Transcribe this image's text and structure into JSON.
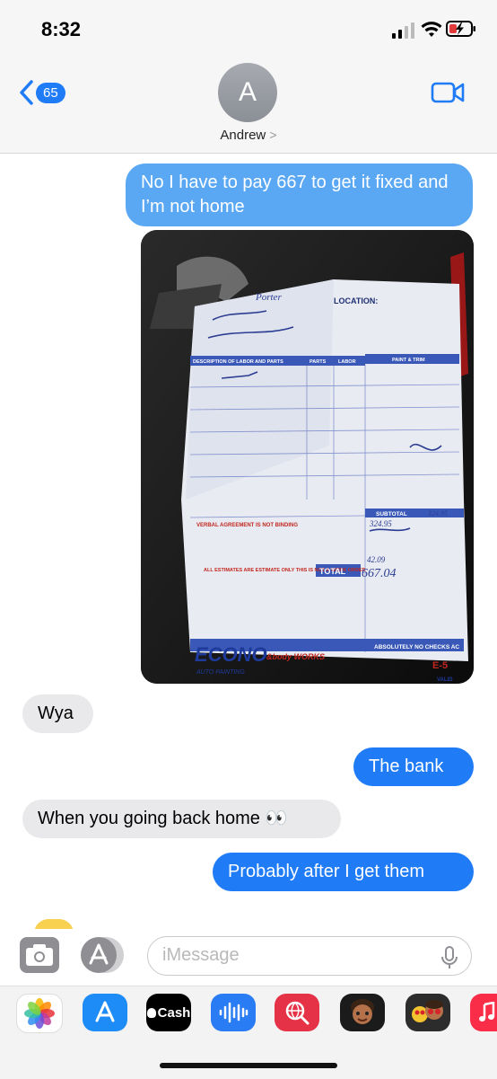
{
  "status_bar": {
    "time": "8:32"
  },
  "header": {
    "back_badge": "65",
    "avatar_initial": "A",
    "contact_name": "Andrew",
    "name_chevron": ">"
  },
  "messages": [
    {
      "type": "sent",
      "text": "No I have to pay 667 to get it fixed and I’m not home"
    },
    {
      "type": "sent-image",
      "text": ""
    },
    {
      "type": "received",
      "text": "Wya"
    },
    {
      "type": "sent",
      "text": "The bank"
    },
    {
      "type": "received",
      "text": "When you going back home 👀"
    },
    {
      "type": "sent",
      "text": "Probably after I get them"
    }
  ],
  "photo": {
    "location_label": "LOCATION:",
    "name_handwritten": "Porter",
    "description_header": "DESCRIPTION OF LABOR AND PARTS",
    "parts_header": "PARTS",
    "labor_header": "LABOR",
    "paint_header": "PAINT & TRIM",
    "verbal_agreement": "VERBAL AGREEMENT IS NOT BINDING",
    "estimates_note": "ALL ESTIMATES ARE ESTIMATE ONLY THIS IS NOT A WORK ORDER",
    "subtotal_label": "SUBTOTAL",
    "subtotal_value": "324.95",
    "total_label": "TOTAL",
    "total_value": "667.04",
    "paint_value": "324.95",
    "tax_value": "42.09",
    "brand": "ECONO",
    "brand_sub": "&body WORKS",
    "brand_tag": "AUTO PAINTING",
    "no_checks": "ABSOLUTELY NO CHECKS AC",
    "form_no": "E-5",
    "valid": "VALID"
  },
  "compose": {
    "placeholder": "iMessage"
  },
  "app_drawer": [
    {
      "name": "photos",
      "label": ""
    },
    {
      "name": "app-store",
      "label": ""
    },
    {
      "name": "apple-cash",
      "label": "Cash"
    },
    {
      "name": "audio-message",
      "label": ""
    },
    {
      "name": "web-search",
      "label": ""
    },
    {
      "name": "memoji",
      "label": ""
    },
    {
      "name": "memoji-stickers",
      "label": ""
    },
    {
      "name": "music",
      "label": ""
    }
  ],
  "colors": {
    "imessage_blue": "#1f7bf6",
    "received_gray": "#e9e9eb",
    "header_bg": "#f6f6f6"
  }
}
